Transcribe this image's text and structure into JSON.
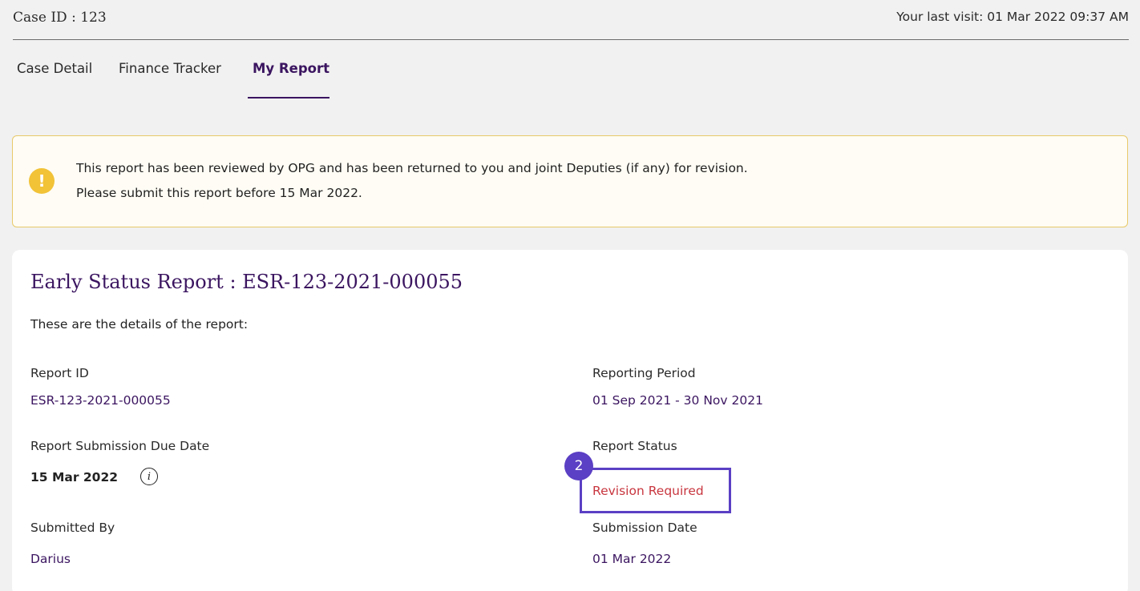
{
  "header": {
    "case_id": "Case ID : 123",
    "last_visit": "Your last visit: 01 Mar 2022 09:37 AM"
  },
  "tabs": [
    {
      "label": "Case Detail",
      "active": false
    },
    {
      "label": "Finance Tracker",
      "active": false
    },
    {
      "label": "My Report",
      "active": true
    }
  ],
  "alert": {
    "icon": "exclamation-icon",
    "icon_glyph": "!",
    "line1": "This report has been reviewed by OPG and has been returned to you and joint Deputies (if any) for revision.",
    "line2": "Please submit this report before 15 Mar 2022."
  },
  "report": {
    "title": "Early Status Report : ESR-123-2021-000055",
    "subtitle": "These are the details of the report:",
    "fields": {
      "report_id": {
        "label": "Report ID",
        "value": "ESR-123-2021-000055"
      },
      "reporting_period": {
        "label": "Reporting Period",
        "value": "01 Sep 2021 - 30 Nov 2021"
      },
      "due_date": {
        "label": "Report Submission Due Date",
        "value": "15 Mar 2022"
      },
      "status": {
        "label": "Report Status",
        "value": "Revision Required"
      },
      "submitted_by": {
        "label": "Submitted By",
        "value": "Darius"
      },
      "submission_date": {
        "label": "Submission Date",
        "value": "01 Mar 2022"
      }
    },
    "info_icon_glyph": "i"
  },
  "annotation": {
    "step_number": "2"
  },
  "colors": {
    "brand_purple": "#3b1560",
    "status_red": "#c8363f",
    "alert_yellow": "#f2c237",
    "annotation_purple": "#5b3fc4"
  }
}
